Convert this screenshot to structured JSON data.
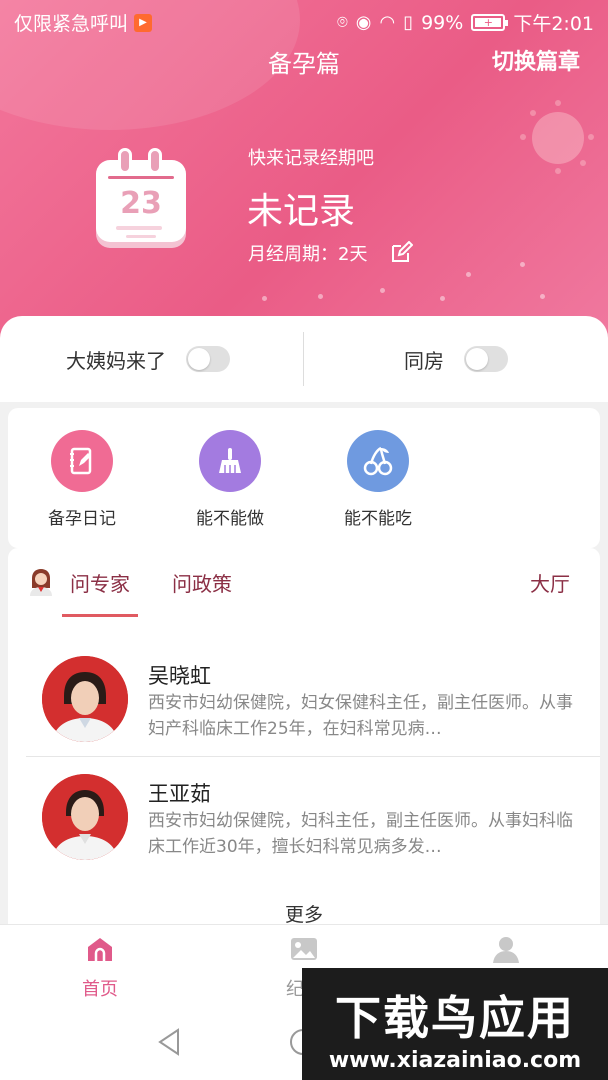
{
  "status_bar": {
    "carrier": "仅限紧急呼叫",
    "battery": "99%",
    "time": "下午2:01"
  },
  "header": {
    "title": "备孕篇",
    "switch_label": "切换篇章",
    "calendar_day": "23",
    "prompt": "快来记录经期吧",
    "record_status": "未记录",
    "cycle": "月经周期：2天"
  },
  "toggles": {
    "period": {
      "label": "大姨妈来了",
      "on": false
    },
    "intimacy": {
      "label": "同房",
      "on": false
    }
  },
  "tools": [
    {
      "label": "备孕日记",
      "icon": "notebook-icon",
      "color": "#f06b94"
    },
    {
      "label": "能不能做",
      "icon": "broom-icon",
      "color": "#a37be0"
    },
    {
      "label": "能不能吃",
      "icon": "cherry-icon",
      "color": "#6f9ae0"
    }
  ],
  "experts_section": {
    "tabs": [
      "问专家",
      "问政策"
    ],
    "active_tab": "问专家",
    "hall": "大厅",
    "experts": [
      {
        "name": "吴晓虹",
        "desc": "西安市妇幼保健院，妇女保健科主任，副主任医师。从事妇产科临床工作25年，在妇科常见病…"
      },
      {
        "name": "王亚茹",
        "desc": "西安市妇幼保健院，妇科主任，副主任医师。从事妇科临床工作近30年，擅长妇科常见病多发…"
      }
    ],
    "more": "更多"
  },
  "bottom_nav": [
    {
      "label": "首页",
      "icon": "home-icon",
      "active": true
    },
    {
      "label": "纪念",
      "icon": "image-icon",
      "active": false
    },
    {
      "label": "我的",
      "icon": "user-icon",
      "active": false
    }
  ],
  "watermark": {
    "logo": "下载鸟应用",
    "url": "www.xiazainiao.com"
  },
  "colors": {
    "header_pink": "#ea5c86",
    "tab_text": "#8b2f45",
    "tab_underline": "#e05a61",
    "active_nav": "#e05a8a"
  }
}
